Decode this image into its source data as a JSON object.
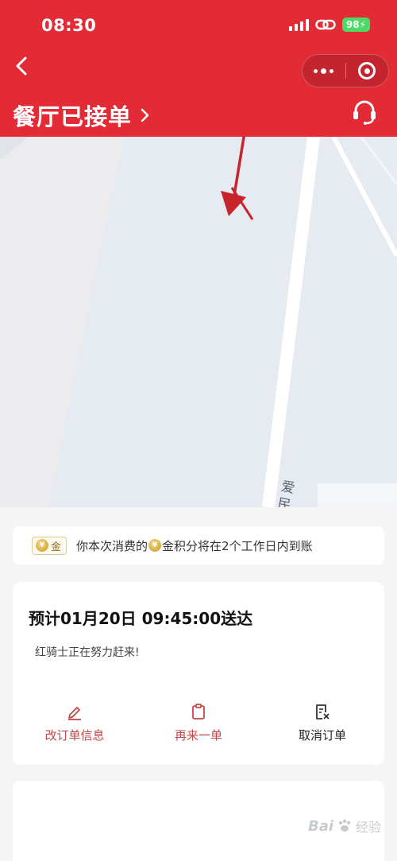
{
  "status_bar": {
    "time": "08:30",
    "battery": "98"
  },
  "header": {
    "order_status": "餐厅已接单",
    "background_color": "#e32b36"
  },
  "map": {
    "road_label": "爱民路"
  },
  "points_banner": {
    "badge_label": "金",
    "text_before": "你本次消费的",
    "text_after": "金积分将在2个工作日内到账"
  },
  "delivery_card": {
    "eta": "预计01月20日 09:45:00送达",
    "rider_status": "红骑士正在努力赶来!",
    "actions": [
      {
        "label": "改订单信息",
        "icon": "edit-icon"
      },
      {
        "label": "再来一单",
        "icon": "clipboard-icon"
      },
      {
        "label": "取消订单",
        "icon": "cancel-order-icon"
      }
    ]
  },
  "watermark": {
    "brand": "Bai",
    "sub": "经验"
  }
}
